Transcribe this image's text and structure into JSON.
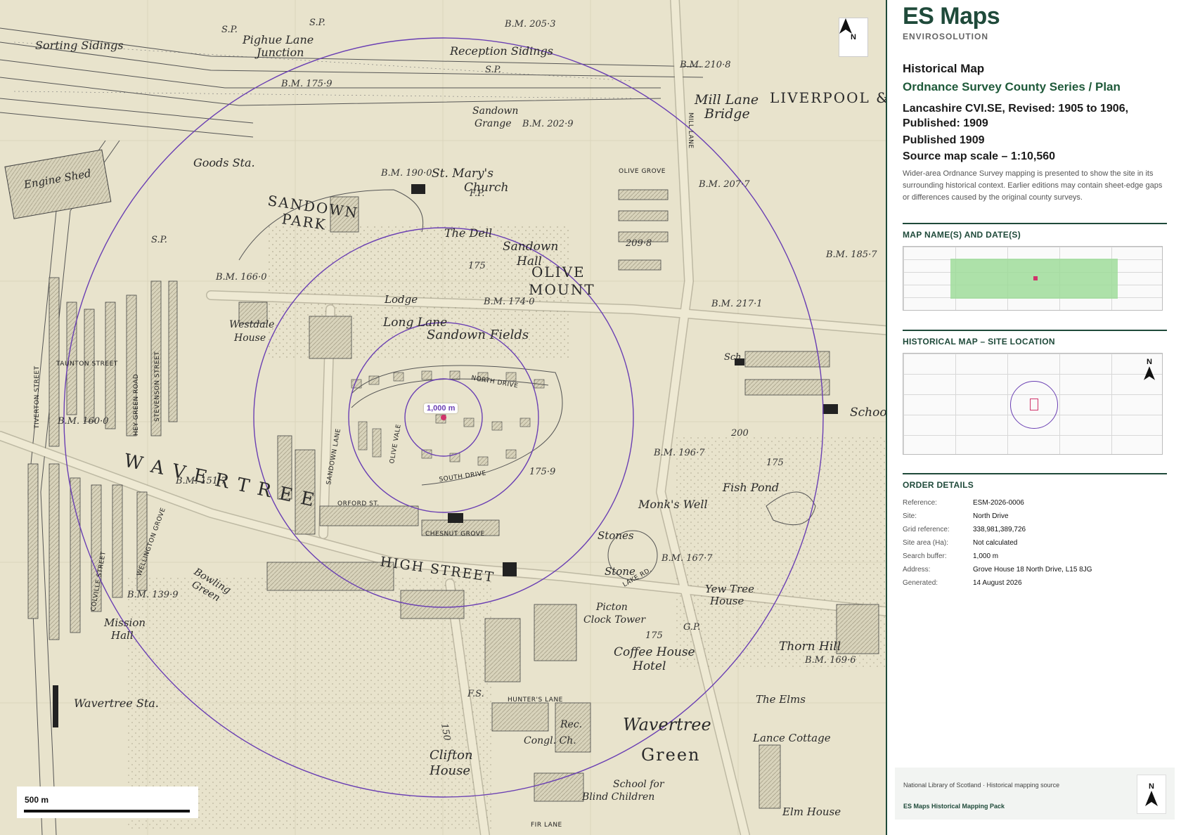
{
  "map": {
    "buffer_label": "1,000 m",
    "scale_label": "500 m",
    "north_label": "N",
    "labels": {
      "sorting_sidings": "Sorting Sidings",
      "pighue_lane_junction_1": "Pighue Lane",
      "pighue_lane_junction_2": "Junction",
      "reception_sidings": "Reception Sidings",
      "mill_lane_bridge_1": "Mill Lane",
      "mill_lane_bridge_2": "Bridge",
      "liverpool": "LIVERPOOL &",
      "engine_shed": "Engine Shed",
      "goods_sta": "Goods Sta.",
      "sandown_grange_1": "Sandown",
      "sandown_grange_2": "Grange",
      "st_marys_1": "St. Mary's",
      "st_marys_2": "Church",
      "sandown_park_1": "SANDOWN",
      "sandown_park_2": "PARK",
      "the_dell": "The Dell",
      "sandown_hall_1": "Sandown",
      "sandown_hall_2": "Hall",
      "olive_mount_1": "OLIVE",
      "olive_mount_2": "MOUNT",
      "lodge": "Lodge",
      "westdale_1": "Westdale",
      "westdale_2": "House",
      "long_lane": "Long Lane",
      "sandown_fields": "Sandown Fields",
      "wavertree_caps": "W A V E R T R E E",
      "monks_well": "Monk's Well",
      "fish_pond": "Fish Pond",
      "stones": "Stones",
      "stone": "Stone",
      "yew_tree_1": "Yew Tree",
      "yew_tree_2": "House",
      "bowling_1": "Bowling",
      "bowling_2": "Green",
      "mission_1": "Mission",
      "mission_2": "Hall",
      "high_street": "HIGH STREET",
      "picton_1": "Picton",
      "picton_2": "Clock Tower",
      "coffee_1": "Coffee House",
      "coffee_2": "Hotel",
      "thorn_hill": "Thorn Hill",
      "the_elms": "The Elms",
      "lance_cottage": "Lance Cottage",
      "wavertree_sta": "Wavertree Sta.",
      "clifton_1": "Clifton",
      "clifton_2": "House",
      "wavertree_green_1": "Wavertree",
      "wavertree_green_2": "Green",
      "school_blind_1": "School for",
      "school_blind_2": "Blind Children",
      "elm_house": "Elm House",
      "congl_ch": "Congl. Ch.",
      "rec": "Rec.",
      "school": "School",
      "sch": "Sch.",
      "bm_205": "B.M. 205·3",
      "bm_210": "B.M. 210·8",
      "bm_175_9": "B.M. 175·9",
      "bm_202": "B.M. 202·9",
      "bm_190": "B.M. 190·0",
      "bm_207": "B.M. 207·7",
      "bm_209": "209·8",
      "bm_185": "B.M. 185·7",
      "bm_166": "B.M. 166·0",
      "bm_174": "B.M. 174·0",
      "bm_217": "B.M. 217·1",
      "bm_160": "B.M. 160·0",
      "bm_151": "B.M. 151·7",
      "bm_196": "B.M. 196·7",
      "bm_167": "B.M. 167·7",
      "bm_139": "B.M. 139·9",
      "bm_169": "B.M. 169·6",
      "olive_grove": "OLIVE GROVE",
      "south_drive": "SOUTH DRIVE",
      "orford_st": "ORFORD ST.",
      "chesnut_grove": "CHESNUT GROVE",
      "hunters_lane": "HUNTER'S LANE",
      "fir_lane": "FIR LANE",
      "north_drive": "NORTH DRIVE",
      "olive_vale": "OLIVE VALE",
      "sandown_lane": "SANDOWN LANE",
      "stevenson_street": "STEVENSON STREET",
      "hey_green_road": "HEY GREEN ROAD",
      "taunton_street": "TAUNTON STREET",
      "tiverton_street": "TIVERTON STREET",
      "colville_street": "COLVILLE STREET",
      "wellington_grove": "WELLINGTON GROVE",
      "lake_rd": "LAKE RD.",
      "mill_lane": "MILL LANE",
      "sp1": "S.P.",
      "sp2": "S.P.",
      "sp3": "S.P.",
      "sp4": "S.P.",
      "fp": "F.P.",
      "gp": "G.P.",
      "fs": "F.S.",
      "h175a": "175",
      "h175b": "175",
      "h175c": "175",
      "h200": "200",
      "h150": "150",
      "h175d": "175·9"
    }
  },
  "panel": {
    "brand": "ES Maps",
    "brand_sub": "ENVIROSOLUTION",
    "title": "Historical Map",
    "series": "Ordnance Survey County Series / Plan",
    "sheet": "Lancashire CVI.SE, Revised: 1905 to 1906, Published: 1909",
    "published": "Published 1909",
    "scale": "Source map scale – 1:10,560",
    "description": "Wider-area Ordnance Survey mapping is presented to show the site in its surrounding historical context. Earlier editions may contain sheet-edge gaps or differences caused by the original county surveys.",
    "section_names": "MAP NAME(S) AND DATE(S)",
    "section_location": "HISTORICAL MAP – SITE LOCATION",
    "section_order": "ORDER DETAILS",
    "order": [
      {
        "k": "Reference:",
        "v": "ESM-2026-0006"
      },
      {
        "k": "Site:",
        "v": "North Drive"
      },
      {
        "k": "Grid reference:",
        "v": "338,981,389,726"
      },
      {
        "k": "Site area (Ha):",
        "v": "Not calculated"
      },
      {
        "k": "Search buffer:",
        "v": "1,000 m"
      },
      {
        "k": "Address:",
        "v": "Grove House 18 North Drive, L15 8JG"
      },
      {
        "k": "Generated:",
        "v": "14 August 2026"
      }
    ],
    "footer_source": "National Library of Scotland · Historical mapping source",
    "footer_pack": "ES Maps Historical Mapping Pack",
    "north_label": "N"
  },
  "colors": {
    "brand": "#1f4a3a",
    "buffer": "#6a3fb3",
    "site": "#d0336a",
    "coverage": "#9fdc9a",
    "map_bg": "#e8e3cc"
  }
}
